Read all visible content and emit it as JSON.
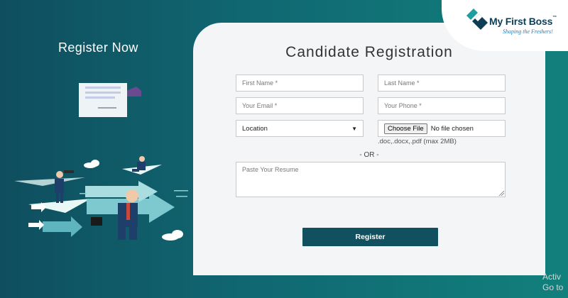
{
  "left_panel": {
    "heading": "Register Now"
  },
  "brand": {
    "name": "My First Boss",
    "trademark": "™",
    "tagline": "Shaping the Freshers!"
  },
  "form": {
    "title": "Candidate Registration",
    "first_name_placeholder": "First Name *",
    "last_name_placeholder": "Last Name *",
    "email_placeholder": "Your Email *",
    "phone_placeholder": "Your Phone *",
    "location_value": "Location",
    "file_button_label": "Choose File",
    "file_status": "No file chosen",
    "file_hint": ".doc,.docx,.pdf (max 2MB)",
    "or_separator": "- OR -",
    "resume_placeholder": "Paste Your Resume",
    "submit_label": "Register"
  },
  "os_overlay": {
    "line1": "Activ",
    "line2": "Go to"
  },
  "icons": {
    "dropdown": "chevron-down-icon",
    "resize": "resize-grip-icon",
    "logo": "my-first-boss-logo-icon"
  },
  "colors": {
    "panel_dark": "#0f4e5f",
    "panel_light": "#12807c",
    "button": "#11515f",
    "logo_navy": "#0d3e56",
    "logo_teal": "#1f9ea0",
    "tagline_blue": "#1e7fbf"
  }
}
